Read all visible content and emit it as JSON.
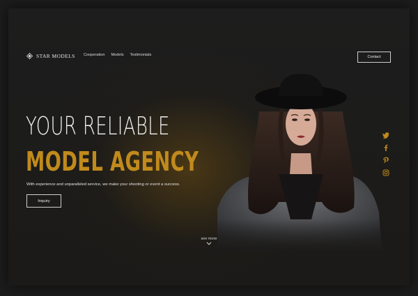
{
  "brand": {
    "name": "STAR MODELS",
    "logo_icon": "diamond-logo-icon"
  },
  "nav": {
    "items": [
      {
        "label": "Cooperation"
      },
      {
        "label": "Models"
      },
      {
        "label": "Testimonials"
      }
    ],
    "contact_label": "Contact"
  },
  "hero": {
    "headline_line1": "YOUR RELIABLE",
    "headline_line2": "MODEL AGENCY",
    "tagline": "With experience and unparalleled service, we make your shooting or event a success.",
    "cta_label": "Inquiry",
    "see_more_label": "see more",
    "image_subject": "model-portrait"
  },
  "social": {
    "icons": [
      "twitter-icon",
      "facebook-icon",
      "pinterest-icon",
      "instagram-icon"
    ]
  },
  "colors": {
    "accent": "#c08a1c",
    "background": "#1c1c1c",
    "text": "#f1f1f1"
  }
}
